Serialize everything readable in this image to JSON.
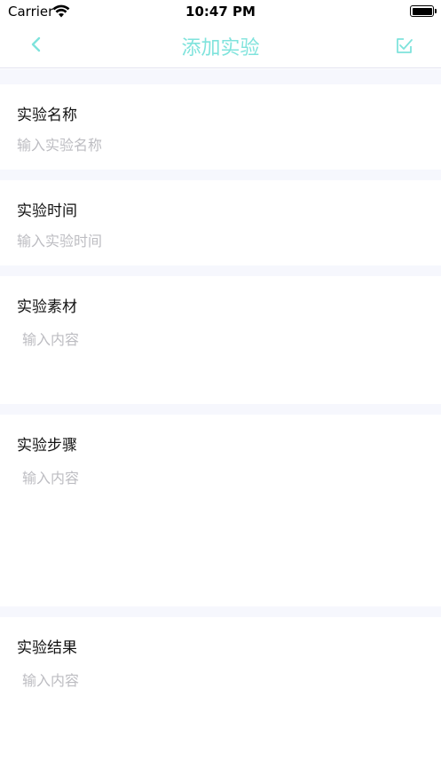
{
  "status_bar": {
    "carrier": "Carrier",
    "time": "10:47 PM"
  },
  "nav": {
    "title": "添加实验",
    "back_icon": "chevron-left-icon",
    "save_icon": "checkbox-check-icon",
    "accent_color": "#7fe3dc"
  },
  "form": {
    "name": {
      "label": "实验名称",
      "placeholder": "输入实验名称",
      "value": ""
    },
    "time": {
      "label": "实验时间",
      "placeholder": "输入实验时间",
      "value": ""
    },
    "materials": {
      "label": "实验素材",
      "placeholder": "输入内容",
      "value": ""
    },
    "steps": {
      "label": "实验步骤",
      "placeholder": "输入内容",
      "value": ""
    },
    "results": {
      "label": "实验结果",
      "placeholder": "输入内容",
      "value": ""
    }
  }
}
